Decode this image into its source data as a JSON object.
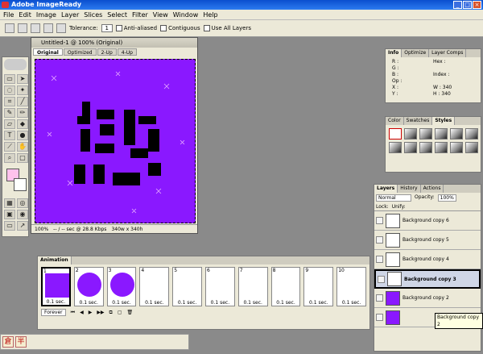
{
  "app": {
    "title": "Adobe ImageReady"
  },
  "menu": [
    "File",
    "Edit",
    "Image",
    "Layer",
    "Slices",
    "Select",
    "Filter",
    "View",
    "Window",
    "Help"
  ],
  "options_bar": {
    "tolerance_label": "Tolerance:",
    "tolerance_value": "1",
    "anti_aliased": "Anti-aliased",
    "contiguous": "Contiguous",
    "use_all_layers": "Use All Layers"
  },
  "document": {
    "title": "Untitled-1 @ 100% (Original)",
    "tabs": [
      "Original",
      "Optimized",
      "2-Up",
      "4-Up"
    ],
    "active_tab": "Original",
    "status": {
      "zoom": "100%",
      "speed": "-- / -- sec @ 28.8 Kbps",
      "size": "340w x 340h"
    }
  },
  "info_panel": {
    "tabs": [
      "Info",
      "Optimize",
      "Layer Comps"
    ],
    "labels": {
      "r": "R :",
      "g": "G :",
      "b": "B :",
      "op": "Op :",
      "hex": "Hex :",
      "index": "Index :",
      "x": "X :",
      "y": "Y :",
      "w": "W :",
      "h": "H :"
    },
    "w_value": "340",
    "h_value": "340"
  },
  "styles_panel": {
    "tabs": [
      "Color",
      "Swatches",
      "Styles"
    ]
  },
  "layers_panel": {
    "tabs": [
      "Layers",
      "History",
      "Actions"
    ],
    "blend_mode": "Normal",
    "opacity_label": "Opacity:",
    "opacity_value": "100%",
    "lock_label": "Lock:",
    "unify_label": "Unify:",
    "layers": [
      {
        "name": "Background copy 6"
      },
      {
        "name": "Background copy 5"
      },
      {
        "name": "Background copy 4"
      },
      {
        "name": "Background copy 3"
      },
      {
        "name": "Background copy 2"
      },
      {
        "name": ""
      }
    ],
    "tooltip": "Background copy 2"
  },
  "animation": {
    "title": "Animation",
    "frames": [
      {
        "num": "1",
        "delay": "0.1 sec."
      },
      {
        "num": "2",
        "delay": "0.1 sec."
      },
      {
        "num": "3",
        "delay": "0.1 sec."
      },
      {
        "num": "4",
        "delay": "0.1 sec."
      },
      {
        "num": "5",
        "delay": "0.1 sec."
      },
      {
        "num": "6",
        "delay": "0.1 sec."
      },
      {
        "num": "7",
        "delay": "0.1 sec."
      },
      {
        "num": "8",
        "delay": "0.1 sec."
      },
      {
        "num": "9",
        "delay": "0.1 sec."
      },
      {
        "num": "10",
        "delay": "0.1 sec."
      }
    ],
    "loop": "Forever"
  },
  "taskbar": {
    "ime1": "倉",
    "ime2": "半"
  },
  "colors": {
    "canvas": "#8a18ff",
    "title_blue": "#0b4fcf"
  }
}
